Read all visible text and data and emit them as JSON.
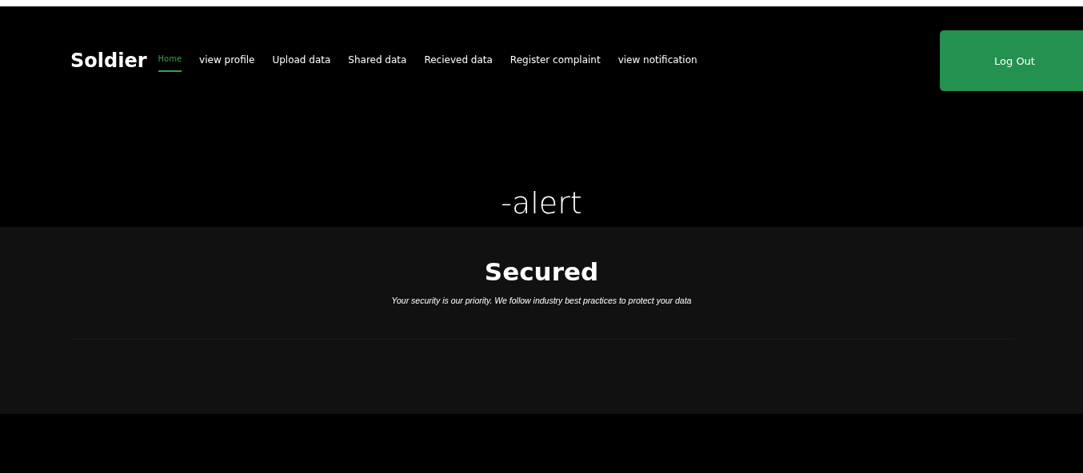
{
  "brand": "Soldier",
  "nav": [
    {
      "label": "Home",
      "selected": true
    },
    {
      "label": "view profile",
      "selected": false
    },
    {
      "label": "Upload data",
      "selected": false
    },
    {
      "label": "Shared data",
      "selected": false
    },
    {
      "label": "Recieved data",
      "selected": false
    },
    {
      "label": "Register complaint",
      "selected": false
    },
    {
      "label": "view notification",
      "selected": false
    }
  ],
  "logout": "Log Out",
  "page_title": "-alert",
  "section": {
    "title": "Secured",
    "text": "Your security is our priority. We follow industry best practices to protect your data"
  }
}
